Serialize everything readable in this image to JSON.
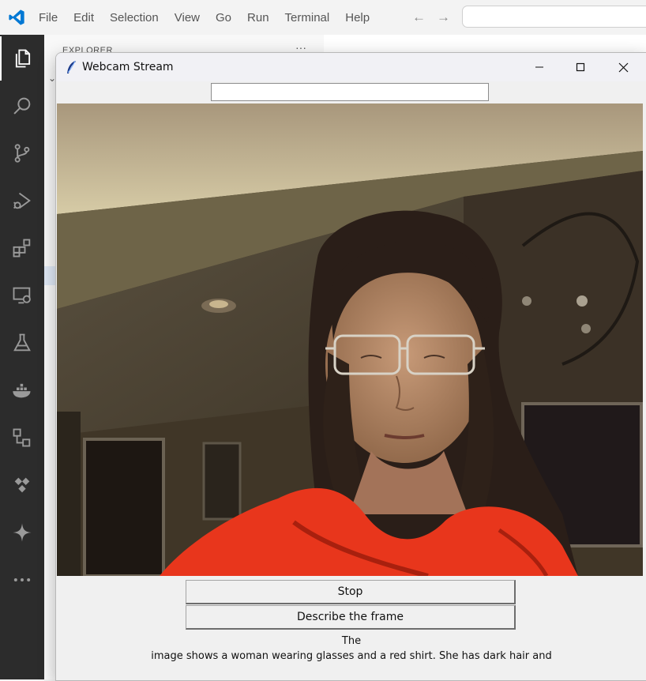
{
  "vscode": {
    "menu": [
      "File",
      "Edit",
      "Selection",
      "View",
      "Go",
      "Run",
      "Terminal",
      "Help"
    ],
    "nav_back": "←",
    "nav_forward": "→",
    "explorer_title": "EXPLORER",
    "explorer_more": "···",
    "activity_icons": [
      "files-icon",
      "search-icon",
      "source-control-icon",
      "run-debug-icon",
      "extensions-icon",
      "remote-explorer-icon",
      "testing-icon",
      "docker-icon",
      "hierarchy-icon",
      "azure-icon",
      "sparkle-icon",
      "more-icon"
    ],
    "accent": "#0078d4"
  },
  "webcam_window": {
    "title": "Webcam Stream",
    "entry_value": "",
    "stop_label": "Stop",
    "describe_label": "Describe the frame",
    "caption_line1": "The",
    "caption_line2": "image shows a woman wearing glasses and a red shirt. She has dark hair and"
  }
}
